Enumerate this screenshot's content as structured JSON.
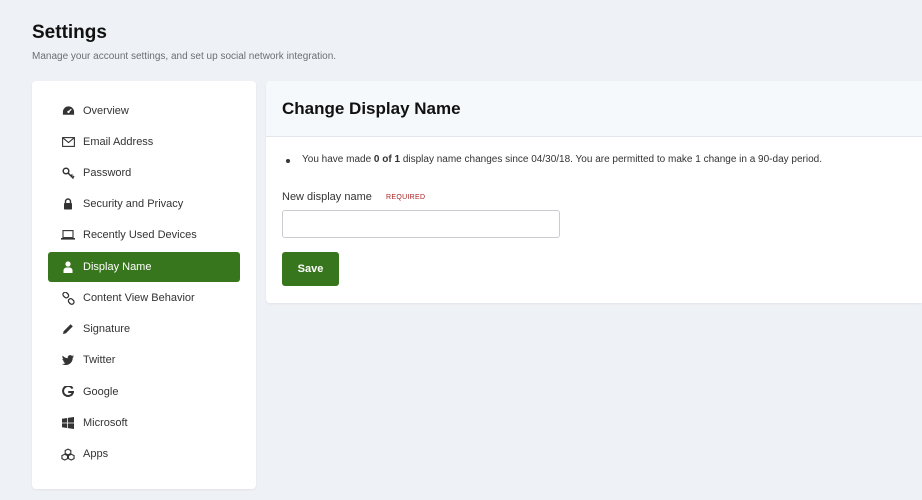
{
  "header": {
    "title": "Settings",
    "subtitle": "Manage your account settings, and set up social network integration."
  },
  "sidebar": {
    "active_item": "Display Name",
    "accent_color": "#38761d",
    "items": [
      {
        "label": "Overview",
        "icon": "dashboard-icon"
      },
      {
        "label": "Email Address",
        "icon": "envelope-icon"
      },
      {
        "label": "Password",
        "icon": "key-icon"
      },
      {
        "label": "Security and Privacy",
        "icon": "lock-icon"
      },
      {
        "label": "Recently Used Devices",
        "icon": "laptop-icon"
      },
      {
        "label": "Display Name",
        "icon": "user-icon"
      },
      {
        "label": "Content View Behavior",
        "icon": "link-icon"
      },
      {
        "label": "Signature",
        "icon": "pencil-icon"
      },
      {
        "label": "Twitter",
        "icon": "twitter-icon"
      },
      {
        "label": "Google",
        "icon": "google-icon"
      },
      {
        "label": "Microsoft",
        "icon": "microsoft-icon"
      },
      {
        "label": "Apps",
        "icon": "cubes-icon"
      }
    ]
  },
  "panel": {
    "title": "Change Display Name",
    "notice_prefix": "You have made ",
    "notice_count": "0 of 1",
    "notice_suffix": " display name changes since 04/30/18. You are permitted to make 1 change in a 90-day period.",
    "field_label": "New display name",
    "required_tag": "REQUIRED",
    "input_value": "",
    "save_label": "Save"
  }
}
